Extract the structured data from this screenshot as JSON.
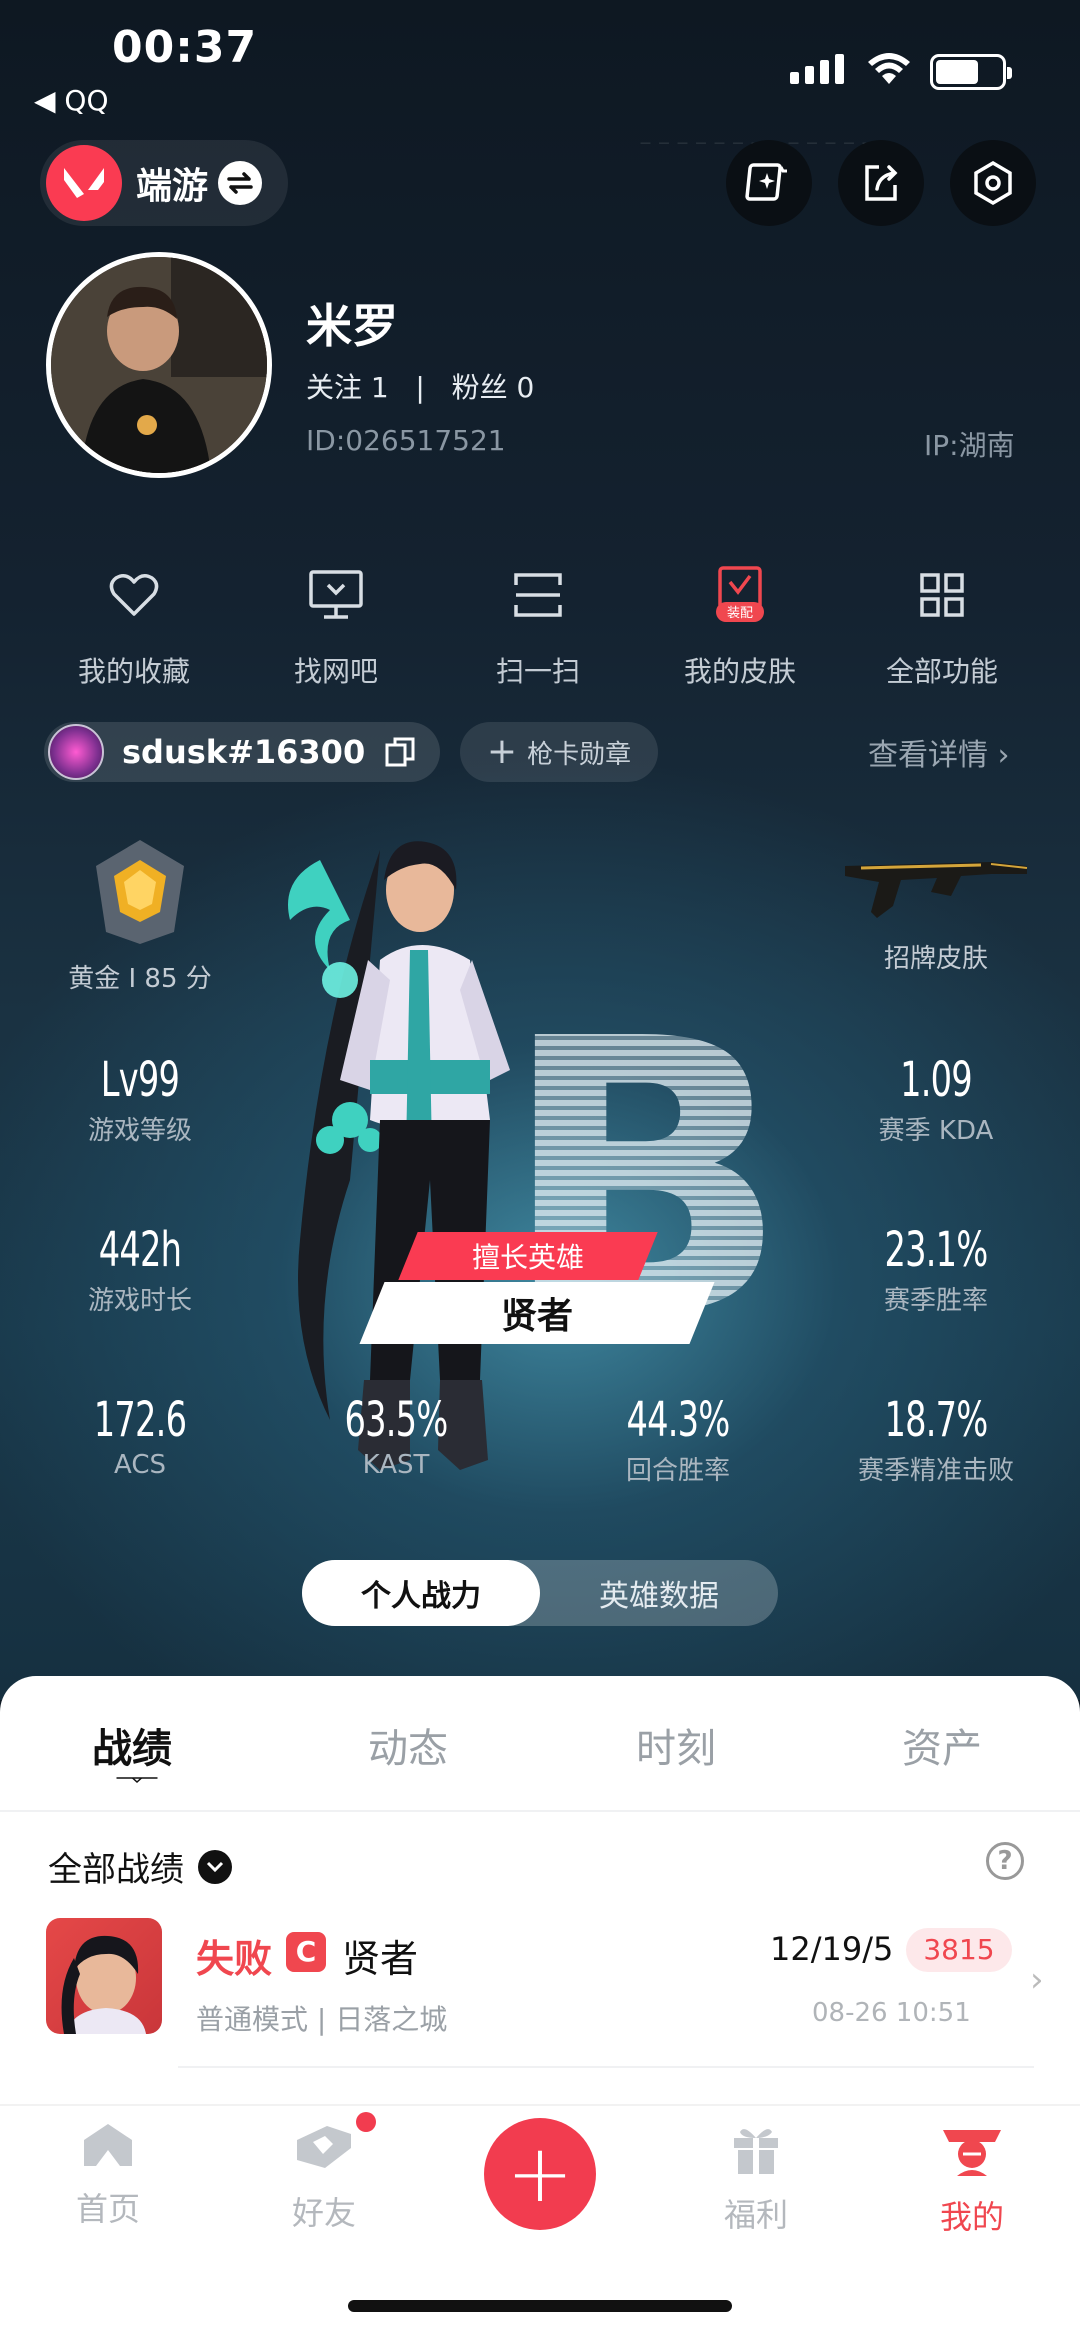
{
  "status_bar": {
    "time": "00:37",
    "back_app": "◀ QQ"
  },
  "header": {
    "game_label": "端游"
  },
  "profile": {
    "name": "米罗",
    "follow_label": "关注 1",
    "fans_label": "粉丝 0",
    "separator": "|",
    "id_text": "ID:026517521",
    "ip_text": "IP:湖南"
  },
  "functions": [
    {
      "label": "我的收藏",
      "icon": "heart-icon"
    },
    {
      "label": "找网吧",
      "icon": "monitor-icon"
    },
    {
      "label": "扫一扫",
      "icon": "scan-icon"
    },
    {
      "label": "我的皮肤",
      "icon": "skin-icon",
      "badge": "装配"
    },
    {
      "label": "全部功能",
      "icon": "grid-icon"
    }
  ],
  "riot": {
    "id": "sdusk#16300",
    "medal_label": "枪卡勋章",
    "detail_label": "查看详情"
  },
  "stats": {
    "rank": {
      "label": "黄金 I 85 分"
    },
    "skin": {
      "label": "招牌皮肤"
    },
    "level": {
      "value": "Lv99",
      "label": "游戏等级"
    },
    "kda": {
      "value": "1.09",
      "label": "赛季 KDA"
    },
    "hours": {
      "value": "442h",
      "label": "游戏时长"
    },
    "winrate": {
      "value": "23.1%",
      "label": "赛季胜率"
    },
    "acs": {
      "value": "172.6",
      "label": "ACS"
    },
    "kast": {
      "value": "63.5%",
      "label": "KAST"
    },
    "round_win": {
      "value": "44.3%",
      "label": "回合胜率"
    },
    "headshot": {
      "value": "18.7%",
      "label": "赛季精准击败"
    }
  },
  "agent": {
    "tag": "擅长英雄",
    "name": "贤者",
    "grade": "B"
  },
  "toggle": {
    "left": "个人战力",
    "right": "英雄数据"
  },
  "tabs": [
    {
      "label": "战绩",
      "active": true
    },
    {
      "label": "动态"
    },
    {
      "label": "时刻"
    },
    {
      "label": "资产"
    }
  ],
  "filter": {
    "label": "全部战绩"
  },
  "matches": [
    {
      "result": "失败",
      "grade": "C",
      "agent": "贤者",
      "mode": "普通模式 | 日落之城",
      "kda": "12/19/5",
      "score": "3815",
      "time": "08-26 10:51"
    }
  ],
  "nav": [
    {
      "label": "首页",
      "icon": "home-icon"
    },
    {
      "label": "好友",
      "icon": "friends-icon"
    },
    {
      "label": "",
      "icon": "plus-icon"
    },
    {
      "label": "福利",
      "icon": "gift-icon"
    },
    {
      "label": "我的",
      "icon": "profile-icon",
      "active": true
    }
  ],
  "colors": {
    "accent": "#f23c4f",
    "background": "#0f1a24",
    "sheet": "#ffffff"
  }
}
